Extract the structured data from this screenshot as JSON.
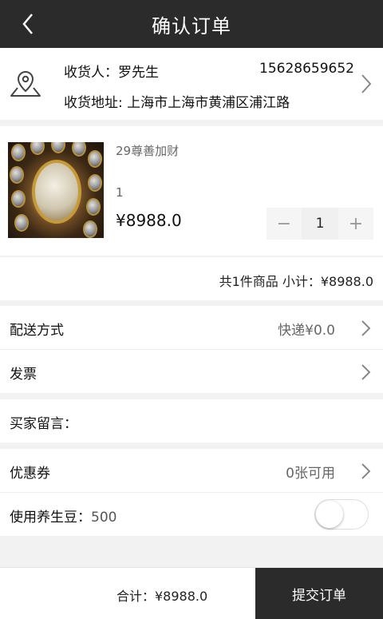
{
  "header": {
    "title": "确认订单",
    "back_icon": "chevron-left-icon"
  },
  "address": {
    "recipient": "收货人：罗先生",
    "phone": "15628659652",
    "address_line": "收货地址: 上海市上海市黄浦区浦江路",
    "location_icon": "location-map-icon",
    "arrow_icon": "chevron-right-icon"
  },
  "product": {
    "name": "29尊善加财",
    "spec": "1",
    "price": "¥8988.0",
    "quantity": "1",
    "minus_label": "−",
    "plus_label": "+"
  },
  "subtotal": {
    "text": "共1件商品  小计：¥8988.0"
  },
  "delivery": {
    "label": "配送方式",
    "value": "快递¥0.0"
  },
  "invoice": {
    "label": "发票"
  },
  "message": {
    "label": "买家留言："
  },
  "coupon": {
    "label": "优惠券",
    "value": "0张可用"
  },
  "beans": {
    "label": "使用养生豆：",
    "value": "500",
    "toggle_on": false
  },
  "footer": {
    "total": "合计：¥8988.0",
    "submit_label": "提交订单"
  },
  "colors": {
    "header_bg": "#2b2b2b",
    "submit_bg": "#2b2b2b",
    "page_bg": "#f2f2f2"
  }
}
